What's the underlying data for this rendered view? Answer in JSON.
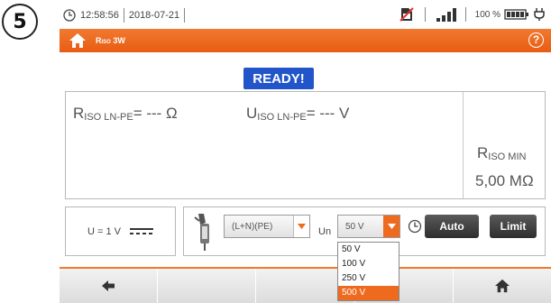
{
  "step_number": "5",
  "status": {
    "time": "12:58:56",
    "date": "2018-07-21",
    "battery_percent": "100 %",
    "signal_bars": 4
  },
  "title": {
    "main": "R",
    "sub": "ISO",
    "suffix": " 3W"
  },
  "ready_label": "READY!",
  "measurements": {
    "r_iso": {
      "main": "R",
      "sub": "ISO LN-PE",
      "value": "= --- Ω"
    },
    "u_iso": {
      "main": "U",
      "sub": "ISO LN-PE",
      "value": "= --- V"
    },
    "r_iso_min": {
      "main": "R",
      "sub": "ISO MIN",
      "value": "5,00 MΩ"
    }
  },
  "voltage_indicator": "U = 1 V",
  "controls": {
    "circuit_select": "(L+N)(PE)",
    "un_label": "Un",
    "un_select": "50 V",
    "auto_button": "Auto",
    "limit_button": "Limit"
  },
  "un_options": [
    "50 V",
    "100 V",
    "250 V",
    "500 V"
  ],
  "un_highlighted_option": 3,
  "colors": {
    "accent": "#ee6a1e",
    "ready_blue": "#2255c9"
  },
  "icons": {
    "home": "home-icon",
    "help": "help-icon",
    "back": "arrow-left-icon",
    "timer": "clock-icon"
  }
}
